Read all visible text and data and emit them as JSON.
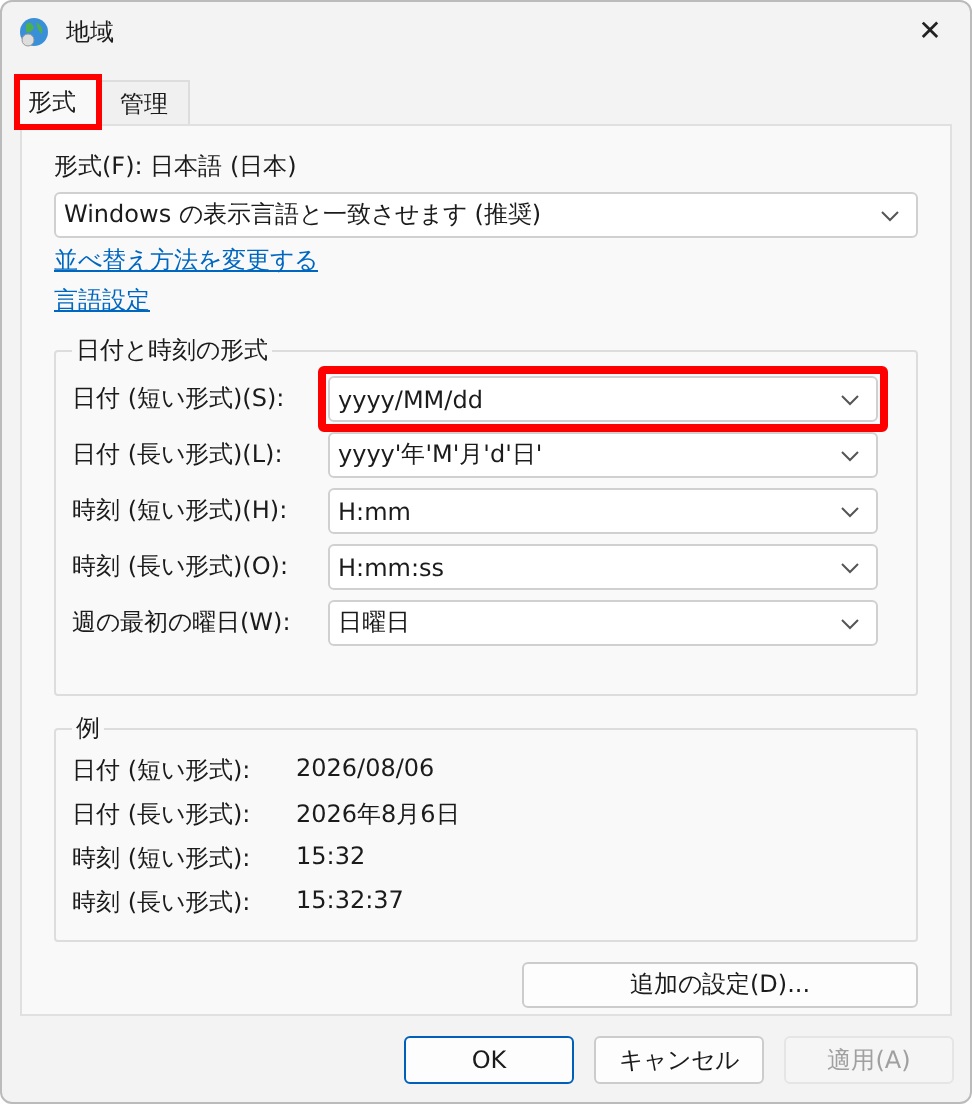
{
  "window": {
    "title": "地域",
    "close": "✕"
  },
  "tabs": [
    {
      "label": "形式",
      "selected": true,
      "highlighted": true
    },
    {
      "label": "管理",
      "selected": false,
      "highlighted": false
    }
  ],
  "format": {
    "label": "形式(F): 日本語 (日本)",
    "value": "Windows の表示言語と一致させます (推奨)"
  },
  "links": [
    "並べ替え方法を変更する",
    "言語設定"
  ],
  "date_time_formats": {
    "title": "日付と時刻の形式",
    "rows": [
      {
        "label": "日付 (短い形式)(S):",
        "value": "yyyy/MM/dd",
        "highlighted": true
      },
      {
        "label": "日付 (長い形式)(L):",
        "value": "yyyy'年'M'月'd'日'",
        "highlighted": false
      },
      {
        "label": "時刻 (短い形式)(H):",
        "value": "H:mm",
        "highlighted": false
      },
      {
        "label": "時刻 (長い形式)(O):",
        "value": "H:mm:ss",
        "highlighted": false
      },
      {
        "label": "週の最初の曜日(W):",
        "value": "日曜日",
        "highlighted": false
      }
    ]
  },
  "examples": {
    "title": "例",
    "rows": [
      {
        "label": "日付 (短い形式):",
        "value": "2026/08/06"
      },
      {
        "label": "日付 (長い形式):",
        "value": "2026年8月6日"
      },
      {
        "label": "時刻 (短い形式):",
        "value": "15:32"
      },
      {
        "label": "時刻 (長い形式):",
        "value": "15:32:37"
      }
    ]
  },
  "additional_button": "追加の設定(D)...",
  "buttons": [
    {
      "label": "OK",
      "default": true,
      "disabled": false
    },
    {
      "label": "キャンセル",
      "default": false,
      "disabled": false
    },
    {
      "label": "適用(A)",
      "default": false,
      "disabled": true
    }
  ]
}
